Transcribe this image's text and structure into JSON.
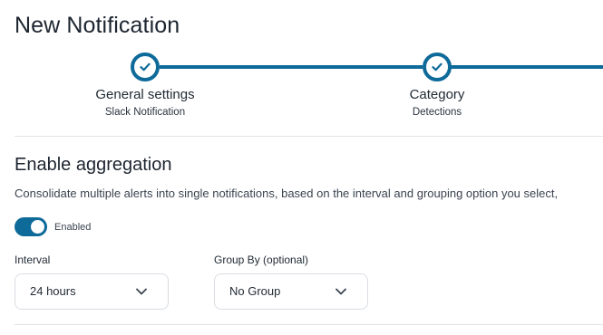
{
  "page": {
    "title": "New Notification"
  },
  "stepper": {
    "steps": [
      {
        "title": "General settings",
        "subtitle": "Slack Notification",
        "status": "completed"
      },
      {
        "title": "Category",
        "subtitle": "Detections",
        "status": "completed"
      }
    ]
  },
  "aggregation": {
    "title": "Enable aggregation",
    "description": "Consolidate multiple alerts into single notifications, based on the interval and grouping option you select,",
    "toggle": {
      "enabled": true,
      "label": "Enabled"
    },
    "interval": {
      "label": "Interval",
      "value": "24 hours"
    },
    "group_by": {
      "label": "Group By (optional)",
      "value": "No Group"
    }
  },
  "colors": {
    "accent": "#0e6a99",
    "border": "#d9dde2",
    "divider": "#e1e4e8"
  },
  "icons": {
    "step_complete": "check-icon",
    "dropdown": "chevron-down-icon"
  }
}
